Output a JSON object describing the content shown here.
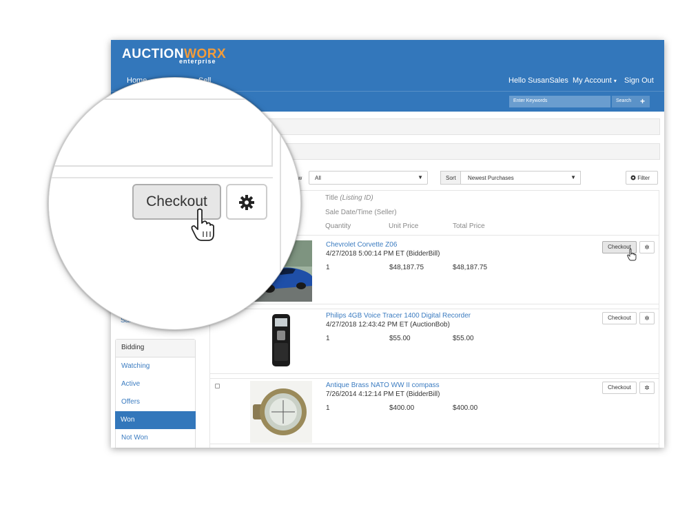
{
  "brand": {
    "logo_main": "AUCTION",
    "logo_accent": "WORX",
    "logo_sub": "enterprise"
  },
  "nav": {
    "home": "Home",
    "sell": "Sell",
    "greeting": "Hello SusanSales",
    "my_account": "My Account",
    "sign_out": "Sign Out"
  },
  "search": {
    "placeholder": "Enter Keywords",
    "button": "Search"
  },
  "toolbar": {
    "view_label": "ew",
    "view_value": "All",
    "sort_label": "Sort",
    "sort_value": "Newest Purchases",
    "filter_label": "Filter"
  },
  "columns": {
    "title": "Title",
    "listing_id": "(Listing ID)",
    "sale_date": "Sale Date/Time (Seller)",
    "quantity": "Quantity",
    "unit_price": "Unit Price",
    "total_price": "Total Price"
  },
  "sidebar": {
    "sales_partial": "Sale",
    "section_title": "Bidding",
    "items": [
      {
        "label": "Watching",
        "active": false
      },
      {
        "label": "Active",
        "active": false
      },
      {
        "label": "Offers",
        "active": false
      },
      {
        "label": "Won",
        "active": true
      },
      {
        "label": "Not Won",
        "active": false
      }
    ]
  },
  "listings": [
    {
      "title": "Chevrolet Corvette Z06",
      "sale": "4/27/2018 5:00:14 PM ET (BidderBill)",
      "quantity": "1",
      "unit_price": "$48,187.75",
      "total_price": "$48,187.75",
      "checkout_label": "Checkout"
    },
    {
      "title": "Philips 4GB Voice Tracer 1400 Digital Recorder",
      "sale": "4/27/2018 12:43:42 PM ET (AuctionBob)",
      "quantity": "1",
      "unit_price": "$55.00",
      "total_price": "$55.00",
      "checkout_label": "Checkout"
    },
    {
      "title": "Antique Brass NATO WW II compass",
      "sale": "7/26/2014 4:12:14 PM ET (BidderBill)",
      "quantity": "1",
      "unit_price": "$400.00",
      "total_price": "$400.00",
      "checkout_label": "Checkout"
    }
  ],
  "magnifier": {
    "checkout_label": "Checkout"
  },
  "colors": {
    "header_blue": "#3377bb",
    "accent_orange": "#f39c3a",
    "link_blue": "#3a7bc0"
  },
  "icons": [
    "gear-icon",
    "plus-icon",
    "circle-icon",
    "hand-cursor-icon",
    "caret-down-icon"
  ]
}
